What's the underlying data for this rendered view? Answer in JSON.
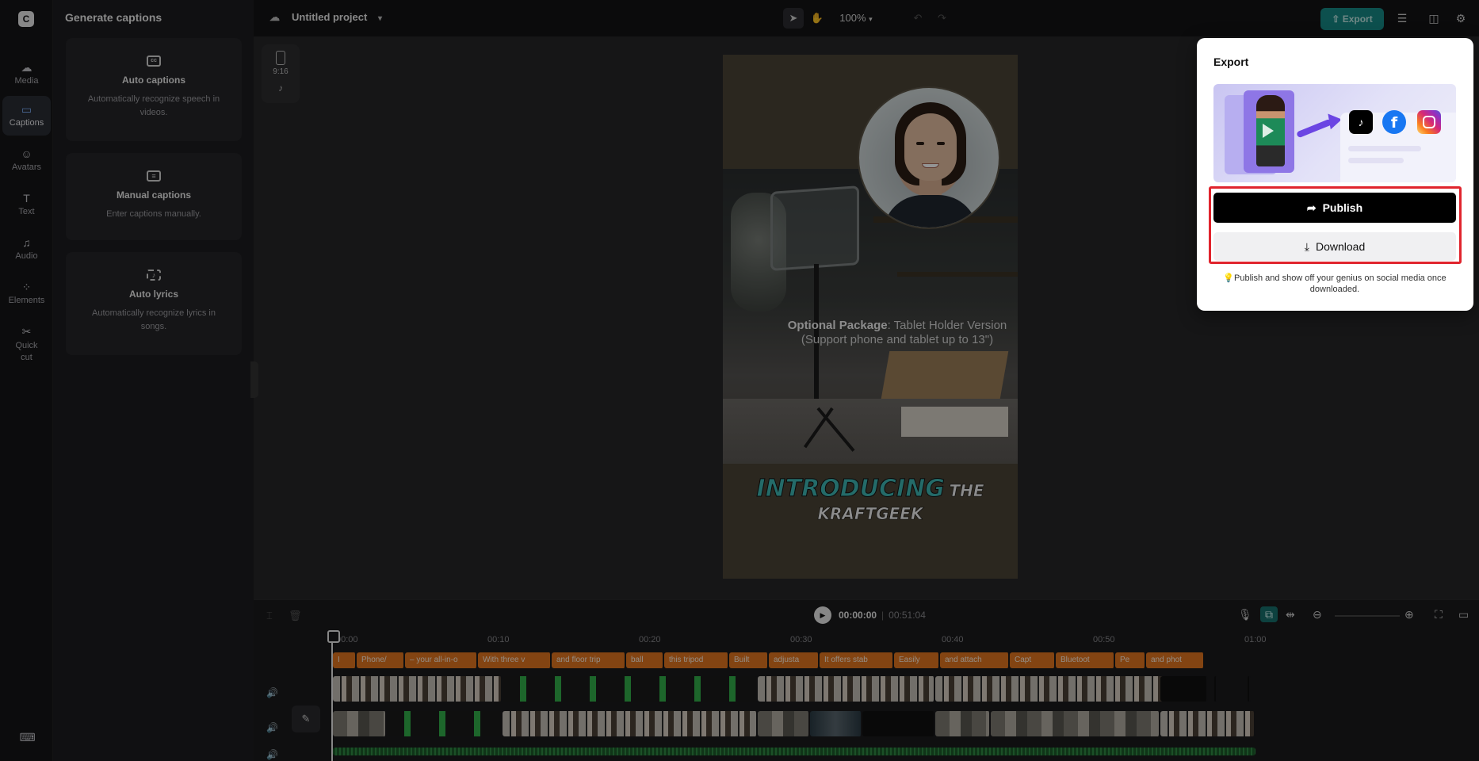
{
  "rail": {
    "items": [
      {
        "label": "Media",
        "icon": "media-icon"
      },
      {
        "label": "Captions",
        "icon": "captions-icon"
      },
      {
        "label": "Avatars",
        "icon": "avatars-icon"
      },
      {
        "label": "Text",
        "icon": "text-icon"
      },
      {
        "label": "Audio",
        "icon": "audio-icon"
      },
      {
        "label": "Elements",
        "icon": "elements-icon"
      },
      {
        "label": "Quick",
        "label2": "cut",
        "icon": "quick-cut-icon"
      }
    ]
  },
  "panel": {
    "title": "Generate captions",
    "cards": [
      {
        "title": "Auto captions",
        "desc": "Automatically recognize speech in videos.",
        "icon": "cc"
      },
      {
        "title": "Manual captions",
        "desc": "Enter captions manually.",
        "icon": ""
      },
      {
        "title": "Auto lyrics",
        "desc": "Automatically recognize lyrics in songs.",
        "icon": ""
      }
    ]
  },
  "topbar": {
    "project_name": "Untitled project",
    "zoom": "100%",
    "export_label": "Export"
  },
  "stage": {
    "ratio_label": "9:16",
    "video_text": {
      "package_bold": "Optional Package",
      "package_rest": ": Tablet Holder Version",
      "package_line2": "(Support phone and tablet up to 13\")",
      "intro_big": "INTRODUCING",
      "intro_the": "THE",
      "intro_brand": "KRAFTGEEK"
    }
  },
  "timeline": {
    "current_time": "00:00:00",
    "duration": "00:51:04",
    "ruler": [
      "00:00",
      "00:10",
      "00:20",
      "00:30",
      "00:40",
      "00:50",
      "01:00"
    ],
    "captions": [
      "I",
      "Phone/",
      "– your all-in-o",
      "With three v",
      "and floor trip",
      "ball",
      "this tripod",
      "Built",
      "adjusta",
      "It offers stab",
      "Easily",
      "and attach",
      "Capt",
      "Bluetoot",
      "Pe",
      "and phot"
    ]
  },
  "export_popover": {
    "title": "Export",
    "publish_label": "Publish",
    "download_label": "Download",
    "tip": "Publish and show off your genius on social media once downloaded.",
    "tiktok_glyph": "♪",
    "facebook_glyph": "f"
  },
  "colors": {
    "accent": "#188a87",
    "caption_clip": "#e2761f",
    "highlight": "#e0242d"
  }
}
